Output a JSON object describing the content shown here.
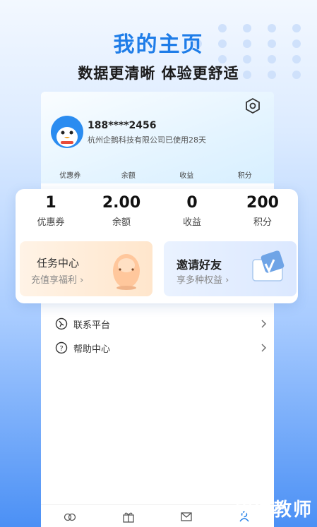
{
  "promo": {
    "headline": "我的主页",
    "subline": "数据更清晰 体验更舒适"
  },
  "profile": {
    "phone": "188****2456",
    "company_status": "杭州企鹅科技有限公司已使用28天"
  },
  "mini_stats": [
    "优惠券",
    "余额",
    "收益",
    "积分"
  ],
  "stats": [
    {
      "value": "1",
      "label": "优惠券"
    },
    {
      "value": "2.00",
      "label": "余额"
    },
    {
      "value": "0",
      "label": "收益"
    },
    {
      "value": "200",
      "label": "积分"
    }
  ],
  "cards": {
    "task": {
      "title": "任务中心",
      "subtitle": "充值享福利 ›"
    },
    "invite": {
      "title": "邀请好友",
      "subtitle": "享多种权益 ›"
    }
  },
  "menu": [
    {
      "label": "联系平台",
      "icon": "contact-icon"
    },
    {
      "label": "帮助中心",
      "icon": "help-icon"
    }
  ],
  "tabbar": [
    "home-icon",
    "gift-icon",
    "message-icon",
    "profile-icon"
  ],
  "watermark": "软件教师",
  "colors": {
    "accent": "#1f7de8",
    "avatar": "#2b8cf0"
  }
}
